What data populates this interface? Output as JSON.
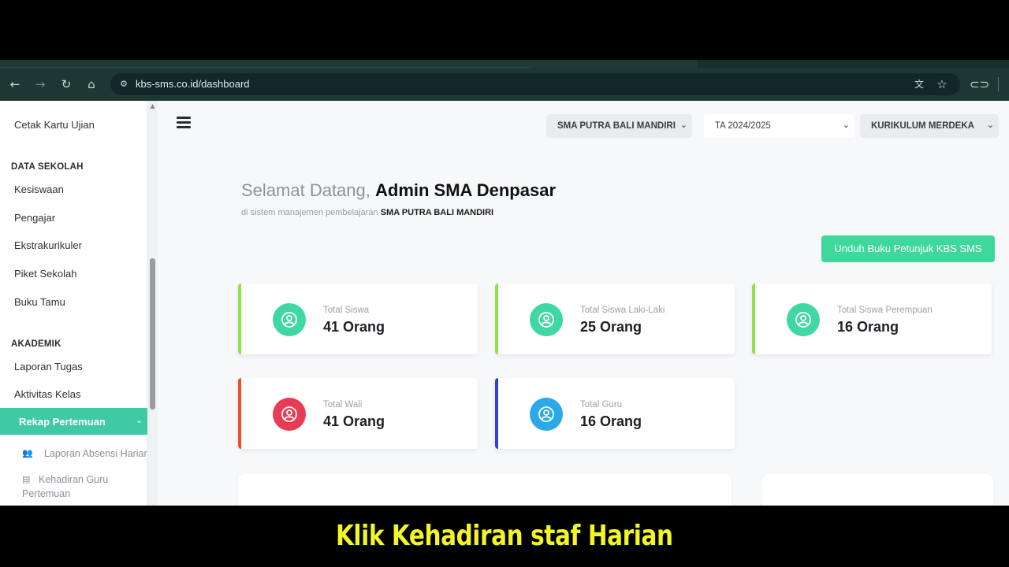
{
  "browser": {
    "url": "kbs-sms.co.id/dashboard",
    "icons": [
      "back-icon",
      "forward-icon",
      "reload-icon",
      "home-icon",
      "site-info-icon",
      "translate-icon",
      "bookmark-star-icon",
      "link-icon"
    ]
  },
  "sidebar": {
    "top_item": "Cetak Kartu Ujian",
    "section_data_sekolah": "DATA SEKOLAH",
    "data_sekolah_items": [
      "Kesiswaan",
      "Pengajar",
      "Ekstrakurikuler",
      "Piket Sekolah",
      "Buku Tamu"
    ],
    "section_akademik": "AKADEMIK",
    "akademik_items": [
      "Laporan Tugas",
      "Aktivitas Kelas"
    ],
    "active_item": "Rekap Pertemuan",
    "sub_items": [
      "Laporan Absensi Harian",
      "Kehadiran Guru",
      "Pertemuan"
    ]
  },
  "topbar": {
    "school_select": "SMA PUTRA BALI MANDIRI",
    "year_select": "TA 2024/2025",
    "curriculum_select": "KURIKULUM MERDEKA"
  },
  "welcome": {
    "greeting": "Selamat Datang,",
    "user": "Admin SMA Denpasar",
    "sub_prefix": "di sistem manajemen pembelajaran",
    "school": "SMA PUTRA BALI MANDIRI"
  },
  "download_button": "Unduh Buku Petunjuk KBS SMS",
  "stats": [
    {
      "label": "Total Siswa",
      "value": "41 Orang",
      "accent": "#8ee24b",
      "icon_color": "#3ed8a0"
    },
    {
      "label": "Total Siswa Laki-Laki",
      "value": "25 Orang",
      "accent": "#8ee24b",
      "icon_color": "#3ed8a0"
    },
    {
      "label": "Total Siswa Perempuan",
      "value": "16 Orang",
      "accent": "#8ee24b",
      "icon_color": "#3ed8a0"
    },
    {
      "label": "Total Wali",
      "value": "41 Orang",
      "accent": "#e8502e",
      "icon_color": "#e63d55"
    },
    {
      "label": "Total Guru",
      "value": "16 Orang",
      "accent": "#2b45c4",
      "icon_color": "#2ca8e6"
    }
  ],
  "caption": "Klik Kehadiran staf Harian"
}
